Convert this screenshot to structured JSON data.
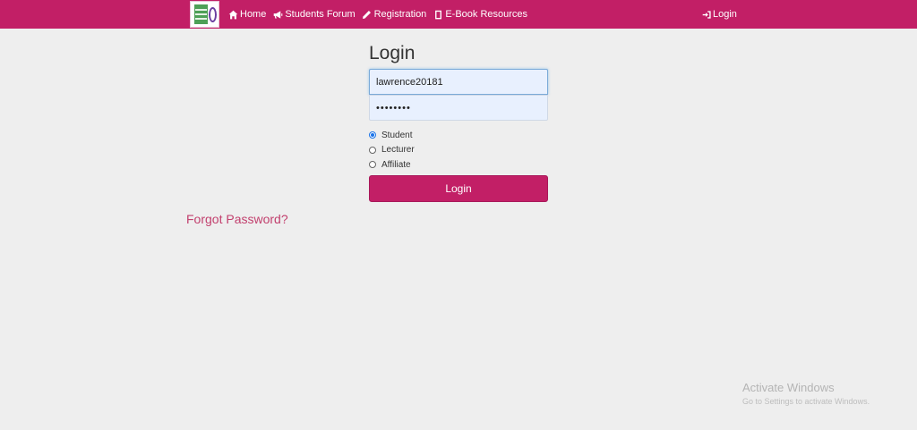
{
  "navbar": {
    "bg_color": "#c21f66",
    "links": [
      {
        "label": "Home",
        "icon": "home-icon"
      },
      {
        "label": "Students Forum",
        "icon": "megaphone-icon"
      },
      {
        "label": "Registration",
        "icon": "pencil-icon"
      },
      {
        "label": "E-Book Resources",
        "icon": "book-icon"
      }
    ],
    "login": {
      "label": "Login",
      "icon": "login-icon"
    }
  },
  "form": {
    "title": "Login",
    "username_value": "lawrence20181",
    "password_value": "••••••••",
    "roles": [
      {
        "label": "Student",
        "checked": true
      },
      {
        "label": "Lecturer",
        "checked": false
      },
      {
        "label": "Affiliate",
        "checked": false
      }
    ],
    "submit_label": "Login",
    "accent_color": "#c21f66"
  },
  "forgot_password": "Forgot Password?",
  "watermark": {
    "title": "Activate Windows",
    "subtitle": "Go to Settings to activate Windows."
  }
}
